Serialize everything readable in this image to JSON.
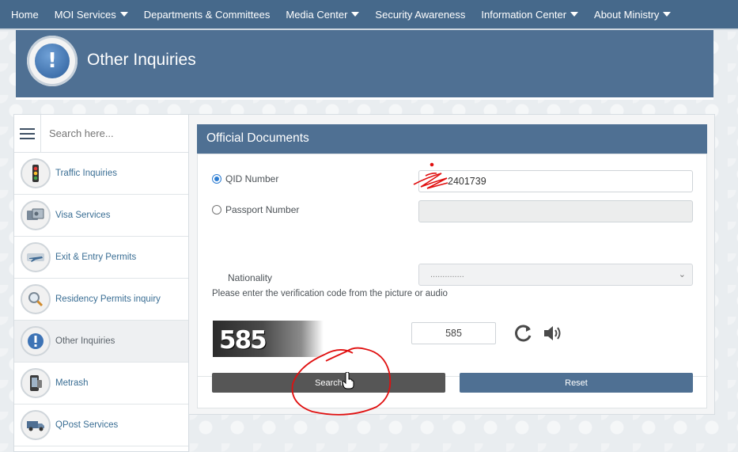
{
  "nav": {
    "items": [
      {
        "label": "Home",
        "dropdown": false
      },
      {
        "label": "MOI Services",
        "dropdown": true
      },
      {
        "label": "Departments & Committees",
        "dropdown": false
      },
      {
        "label": "Media Center",
        "dropdown": true
      },
      {
        "label": "Security Awareness",
        "dropdown": false
      },
      {
        "label": "Information Center",
        "dropdown": true
      },
      {
        "label": "About Ministry",
        "dropdown": true
      }
    ]
  },
  "banner": {
    "title": "Other Inquiries",
    "icon": "exclamation-icon"
  },
  "sidebar": {
    "search_placeholder": "Search here...",
    "items": [
      {
        "label": "Traffic Inquiries",
        "icon": "traffic-light-icon",
        "active": false
      },
      {
        "label": "Visa Services",
        "icon": "visa-icon",
        "active": false
      },
      {
        "label": "Exit & Entry Permits",
        "icon": "airplane-icon",
        "active": false
      },
      {
        "label": "Residency Permits inquiry",
        "icon": "magnifier-icon",
        "active": false
      },
      {
        "label": "Other Inquiries",
        "icon": "exclamation-icon",
        "active": true
      },
      {
        "label": "Metrash",
        "icon": "phone-icon",
        "active": false
      },
      {
        "label": "QPost Services",
        "icon": "truck-icon",
        "active": false
      }
    ]
  },
  "panel": {
    "title": "Official Documents",
    "qid_label": "QID Number",
    "qid_value": "2401739",
    "qid_selected": true,
    "passport_label": "Passport Number",
    "passport_value": "",
    "nationality_label": "Nationality",
    "nationality_value": "..............",
    "verify_text": "Please enter the verification code from the picture or audio",
    "captcha_text": "585",
    "captcha_input_value": "585",
    "search_label": "Search",
    "reset_label": "Reset"
  },
  "colors": {
    "nav_bg": "#46698b",
    "header_bg": "#4f7093",
    "search_btn": "#565656",
    "reset_btn": "#4f7093",
    "annotation": "#e01010"
  }
}
